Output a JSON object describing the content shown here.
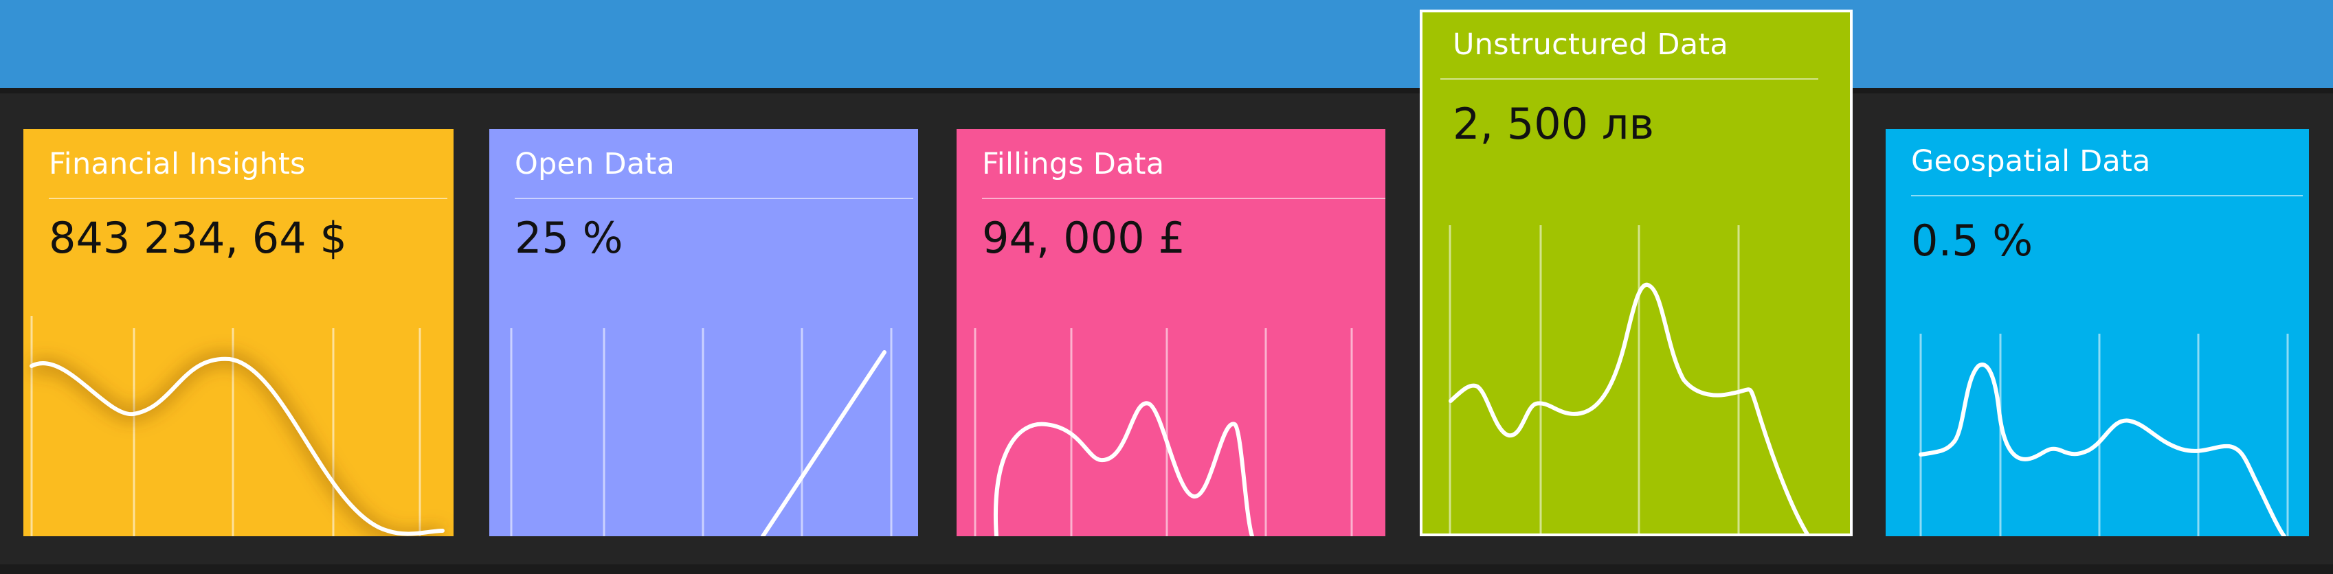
{
  "cards": [
    {
      "title": "Financial Insights",
      "value": "843 234, 64 $",
      "color": "#fbbc1f"
    },
    {
      "title": "Open Data",
      "value": "25 %",
      "color": "#8c9bff"
    },
    {
      "title": "Fillings Data",
      "value": "94, 000 £",
      "color": "#f75495"
    },
    {
      "title": "Unstructured Data",
      "value": "2, 500 лв",
      "color": "#a1c301",
      "selected": true
    },
    {
      "title": "Geospatial Data",
      "value": "0.5 %",
      "color": "#00b1ec"
    }
  ]
}
